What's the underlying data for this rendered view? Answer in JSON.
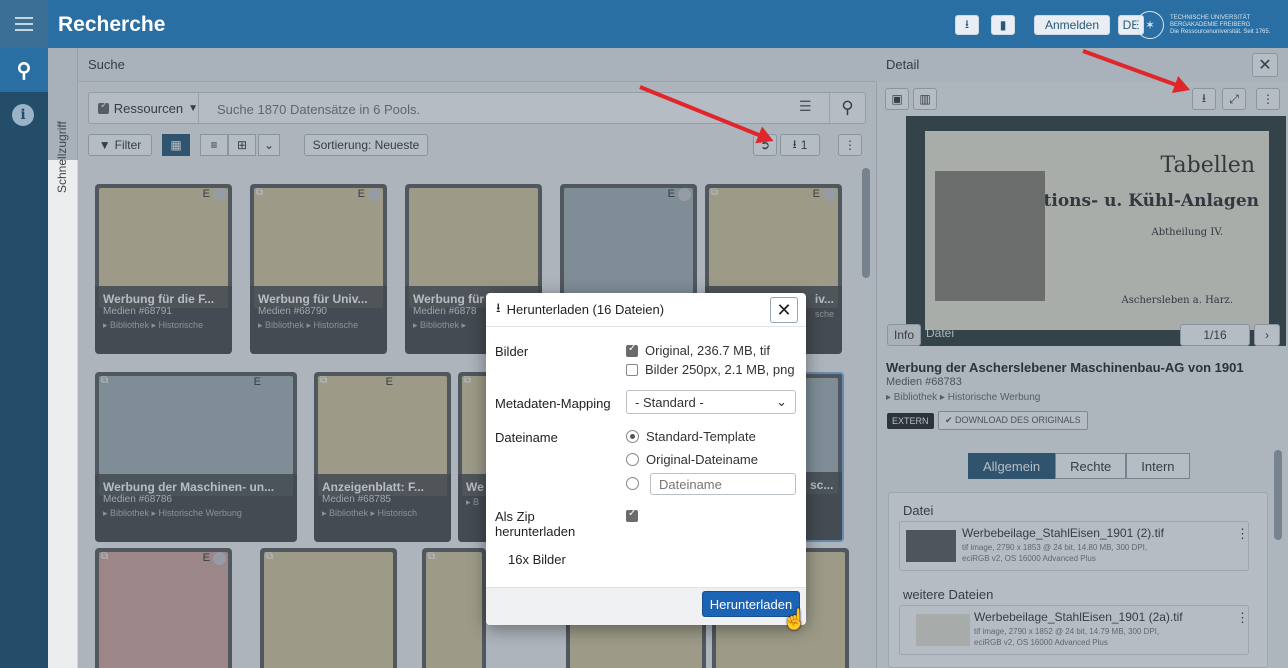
{
  "app": {
    "title": "Recherche",
    "login_label": "Anmelden",
    "lang": "DE",
    "logo_lines": [
      "TECHNISCHE UNIVERSITÄT",
      "BERGAKADEMIE FREIBERG",
      "Die Ressourcenuniversität. Seit 1765."
    ]
  },
  "rail": {
    "quick_access": "Schnellzugriff"
  },
  "search": {
    "header": "Suche",
    "resource_label": "Ressourcen",
    "placeholder": "Suche 1870 Datensätze in 6 Pools.",
    "filter_label": "Filter",
    "sort_label": "Sortierung: Neueste",
    "download_count": "1"
  },
  "cards": [
    {
      "title": "Werbung für die F...",
      "media": "Medien #68791",
      "bc": "▸ Bibliothek ▸ Historische"
    },
    {
      "title": "Werbung für Univ...",
      "media": "Medien #68790",
      "bc": "▸ Bibliothek ▸ Historische"
    },
    {
      "title": "Werbung für",
      "media": "Medien #6878",
      "bc": "▸ Bibliothek ▸"
    },
    {
      "title": "",
      "media": "",
      "bc": ""
    },
    {
      "title": "iv...",
      "media": "",
      "bc": "sche"
    },
    {
      "title": "Werbung der Maschinen- un...",
      "media": "Medien #68786",
      "bc": "▸ Bibliothek ▸ Historische Werbung"
    },
    {
      "title": "Anzeigenblatt: F...",
      "media": "Medien #68785",
      "bc": "▸ Bibliothek ▸ Historisch"
    },
    {
      "title": "We",
      "media": "",
      "bc": "▸ B"
    },
    {
      "title": "sc...",
      "media": "",
      "bc": ""
    }
  ],
  "detail": {
    "header": "Detail",
    "preview_text": [
      "Tabellen",
      "Condensations- u. Kühl-Anlagen",
      "Abtheilung IV.",
      "Aschersleben a. Harz."
    ],
    "info_tab": "Info",
    "file_tab": "Datei",
    "pager": "1/16",
    "title": "Werbung der Ascherslebener Maschinenbau-AG von 1901",
    "media": "Medien #68783",
    "breadcrumb": "▸ Bibliothek ▸ Historische Werbung",
    "badge_extern": "EXTERN",
    "badge_download": "DOWNLOAD DES ORIGINALS",
    "tabs": [
      "Allgemein",
      "Rechte",
      "Intern"
    ],
    "file_section": "Datei",
    "file1_name": "Werbebeilage_StahlEisen_1901 (2).tif",
    "file1_meta1": "tif image, 2790 x 1853 @ 24 bit, 14.80 MB, 300 DPI,",
    "file1_meta2": "eciRGB v2, OS 16000 Advanced Plus",
    "more_section": "weitere Dateien",
    "file2_name": "Werbebeilage_StahlEisen_1901 (2a).tif",
    "file2_meta1": "tif image, 2790 x 1852 @ 24 bit, 14.79 MB, 300 DPI,",
    "file2_meta2": "eciRGB v2, OS 16000 Advanced Plus"
  },
  "dialog": {
    "title": "Herunterladen (16 Dateien)",
    "images_label": "Bilder",
    "opt_original": "Original, 236.7 MB, tif",
    "opt_250": "Bilder 250px, 2.1 MB, png",
    "mapping_label": "Metadaten-Mapping",
    "mapping_value": "- Standard -",
    "filename_label": "Dateiname",
    "radio_standard": "Standard-Template",
    "radio_original": "Original-Dateiname",
    "filename_placeholder": "Dateiname",
    "zip_label_1": "Als Zip",
    "zip_label_2": "herunterladen",
    "count": "16x Bilder",
    "download_label": "Herunterladen"
  }
}
